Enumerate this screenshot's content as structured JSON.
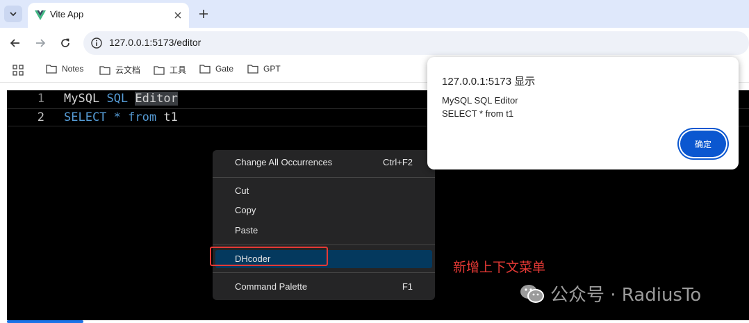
{
  "browser": {
    "tab": {
      "title": "Vite App",
      "favicon": "vue-logo-icon"
    },
    "address_bar": {
      "url": "127.0.0.1:5173/editor"
    },
    "bookmarks": [
      {
        "label": "Notes",
        "icon": "folder-icon"
      },
      {
        "label": "云文档",
        "icon": "folder-icon"
      },
      {
        "label": "工具",
        "icon": "folder-icon"
      },
      {
        "label": "Gate",
        "icon": "folder-icon"
      },
      {
        "label": "GPT",
        "icon": "folder-icon"
      }
    ]
  },
  "editor": {
    "lines": [
      {
        "number": "1",
        "tokens": [
          "MySQL",
          "SQL",
          "Editor"
        ]
      },
      {
        "number": "2",
        "tokens": [
          "SELECT",
          "*",
          "from",
          "t1"
        ]
      }
    ]
  },
  "context_menu": {
    "items": [
      {
        "label": "Change All Occurrences",
        "shortcut": "Ctrl+F2"
      },
      {
        "label": "Cut",
        "shortcut": ""
      },
      {
        "label": "Copy",
        "shortcut": ""
      },
      {
        "label": "Paste",
        "shortcut": ""
      },
      {
        "label": "DHcoder",
        "shortcut": ""
      },
      {
        "label": "Command Palette",
        "shortcut": "F1"
      }
    ]
  },
  "annotation": {
    "text": "新增上下文菜单",
    "color": "#e53935"
  },
  "alert": {
    "title": "127.0.0.1:5173 显示",
    "message_line1": "MySQL SQL Editor",
    "message_line2": "SELECT * from t1",
    "ok_label": "确定"
  },
  "watermark": {
    "text": "公众号 · RadiusTo"
  },
  "colors": {
    "accent": "#0b57d0",
    "keyword": "#569cd6",
    "menu_active": "#04395e",
    "tabstrip": "#dfe8fb"
  }
}
